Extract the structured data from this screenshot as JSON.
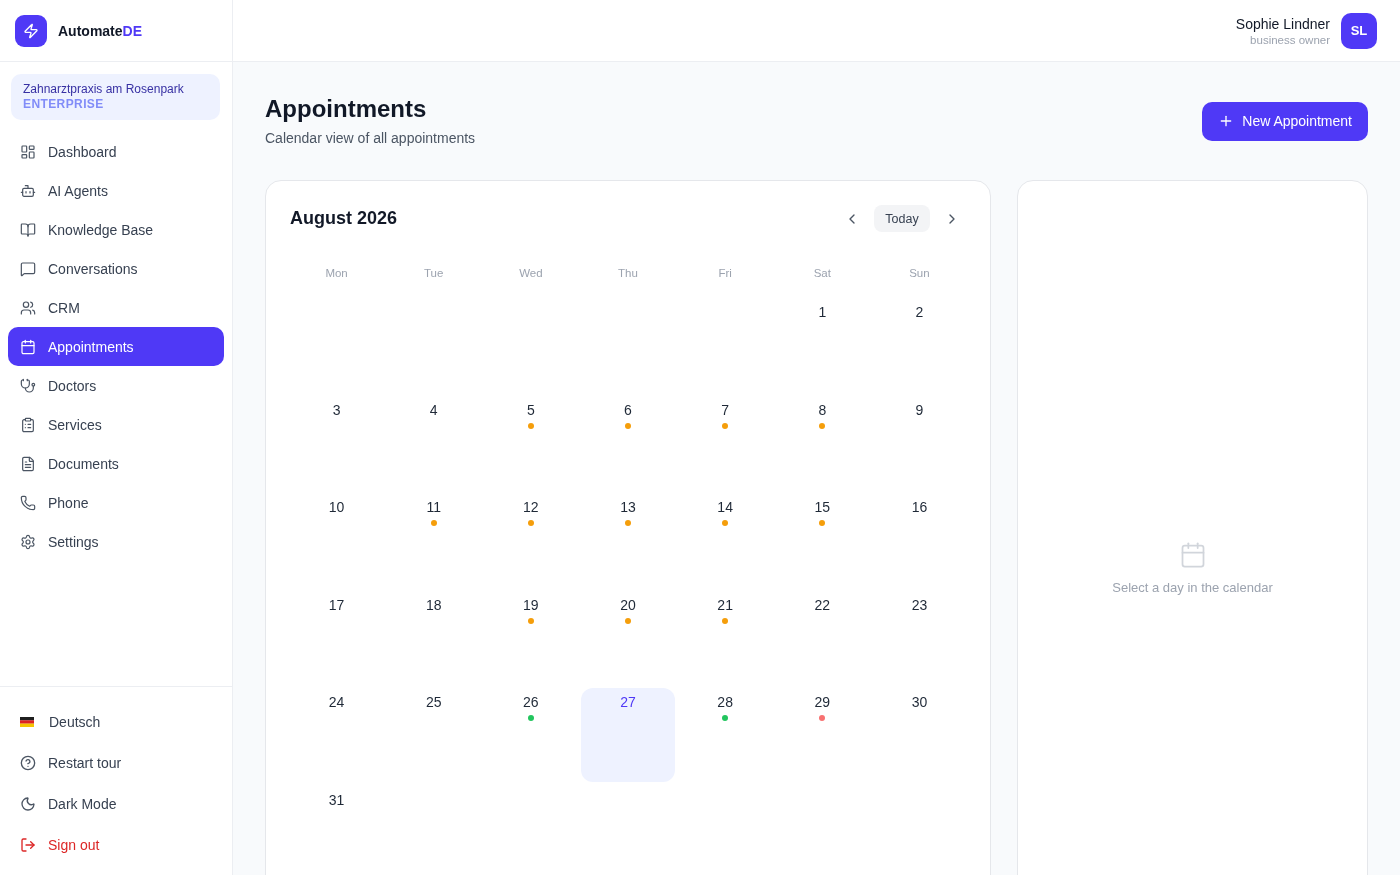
{
  "sidebar": {
    "brand": {
      "name": "Automate",
      "accent": "DE"
    },
    "organization": {
      "name": "Zahnarztpraxis am Rosenpark",
      "plan": "ENTERPRISE"
    },
    "nav_items": [
      {
        "kind": "dashboard",
        "label": "Dashboard",
        "selected": false
      },
      {
        "kind": "agents",
        "label": "AI Agents",
        "selected": false
      },
      {
        "kind": "knowledge",
        "label": "Knowledge Base",
        "selected": false
      },
      {
        "kind": "conversations",
        "label": "Conversations",
        "selected": false
      },
      {
        "kind": "crm",
        "label": "CRM",
        "selected": false
      },
      {
        "kind": "appointments",
        "label": "Appointments",
        "selected": true
      },
      {
        "kind": "doctors",
        "label": "Doctors",
        "selected": false
      },
      {
        "kind": "services",
        "label": "Services",
        "selected": false
      },
      {
        "kind": "documents",
        "label": "Documents",
        "selected": false
      },
      {
        "kind": "phone",
        "label": "Phone",
        "selected": false
      },
      {
        "kind": "settings",
        "label": "Settings",
        "selected": false
      }
    ],
    "footer_items": [
      {
        "kind": "language",
        "label": "Deutsch"
      },
      {
        "kind": "help",
        "label": "Restart tour"
      },
      {
        "kind": "theme",
        "label": "Dark Mode"
      },
      {
        "kind": "signout",
        "label": "Sign out"
      }
    ]
  },
  "header": {
    "user": {
      "name": "Sophie Lindner",
      "role": "business owner",
      "initials": "SL"
    }
  },
  "page": {
    "title": "Appointments",
    "subtitle": "Calendar view of all appointments",
    "new_button": "New Appointment"
  },
  "calendar": {
    "month": "August 2026",
    "today_button": "Today",
    "weekdays": [
      "Mon",
      "Tue",
      "Wed",
      "Thu",
      "Fri",
      "Sat",
      "Sun"
    ],
    "weeks": [
      [
        {
          "kind": "blank"
        },
        {
          "kind": "blank"
        },
        {
          "kind": "blank"
        },
        {
          "kind": "blank"
        },
        {
          "kind": "blank"
        },
        {
          "kind": "day",
          "label": "1",
          "today": false
        },
        {
          "kind": "day",
          "label": "2",
          "today": false
        }
      ],
      [
        {
          "kind": "day",
          "label": "3",
          "today": false
        },
        {
          "kind": "day",
          "label": "4",
          "today": false
        },
        {
          "kind": "day",
          "label": "5",
          "today": false,
          "color": "#f59e0b"
        },
        {
          "kind": "day",
          "label": "6",
          "today": false,
          "color": "#f59e0b"
        },
        {
          "kind": "day",
          "label": "7",
          "today": false,
          "color": "#f59e0b"
        },
        {
          "kind": "day",
          "label": "8",
          "today": false,
          "color": "#f59e0b"
        },
        {
          "kind": "day",
          "label": "9",
          "today": false
        }
      ],
      [
        {
          "kind": "day",
          "label": "10",
          "today": false
        },
        {
          "kind": "day",
          "label": "11",
          "today": false,
          "color": "#f59e0b"
        },
        {
          "kind": "day",
          "label": "12",
          "today": false,
          "color": "#f59e0b"
        },
        {
          "kind": "day",
          "label": "13",
          "today": false,
          "color": "#f59e0b"
        },
        {
          "kind": "day",
          "label": "14",
          "today": false,
          "color": "#f59e0b"
        },
        {
          "kind": "day",
          "label": "15",
          "today": false,
          "color": "#f59e0b"
        },
        {
          "kind": "day",
          "label": "16",
          "today": false
        }
      ],
      [
        {
          "kind": "day",
          "label": "17",
          "today": false
        },
        {
          "kind": "day",
          "label": "18",
          "today": false
        },
        {
          "kind": "day",
          "label": "19",
          "today": false,
          "color": "#f59e0b"
        },
        {
          "kind": "day",
          "label": "20",
          "today": false,
          "color": "#f59e0b"
        },
        {
          "kind": "day",
          "label": "21",
          "today": false,
          "color": "#f59e0b"
        },
        {
          "kind": "day",
          "label": "22",
          "today": false
        },
        {
          "kind": "day",
          "label": "23",
          "today": false
        }
      ],
      [
        {
          "kind": "day",
          "label": "24",
          "today": false
        },
        {
          "kind": "day",
          "label": "25",
          "today": false
        },
        {
          "kind": "day",
          "label": "26",
          "today": false,
          "color": "#22c55e"
        },
        {
          "kind": "day",
          "label": "27",
          "today": true
        },
        {
          "kind": "day",
          "label": "28",
          "today": false,
          "color": "#22c55e"
        },
        {
          "kind": "day",
          "label": "29",
          "today": false,
          "color": "#f87171"
        },
        {
          "kind": "day",
          "label": "30",
          "today": false
        }
      ],
      [
        {
          "kind": "day",
          "label": "31",
          "today": false
        }
      ]
    ]
  },
  "day_panel": {
    "empty_text": "Select a day in the calendar"
  }
}
